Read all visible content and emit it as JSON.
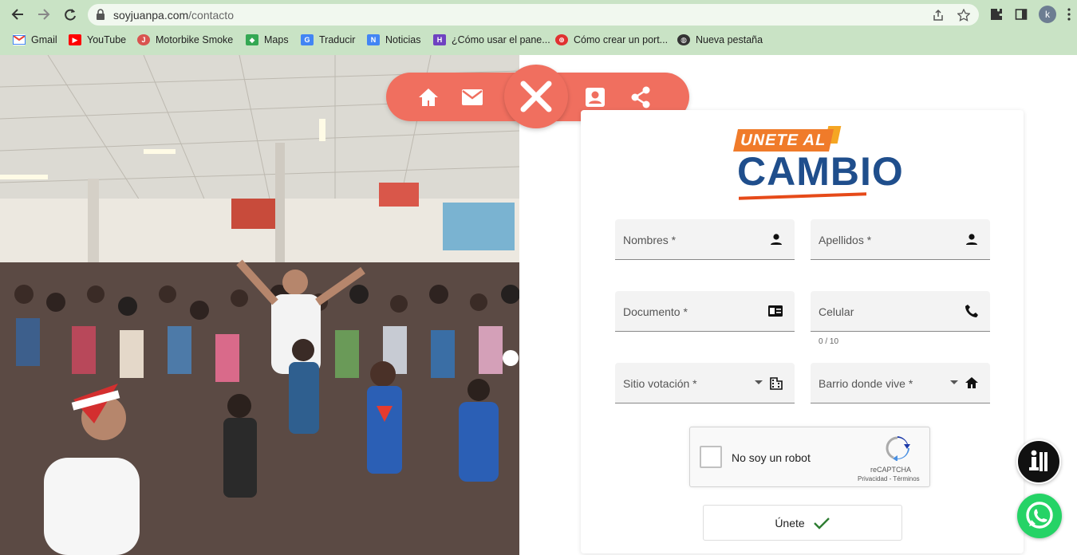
{
  "browser": {
    "url_host": "soyjuanpa.com",
    "url_path": "/contacto",
    "profile_initial": "k",
    "bookmarks": [
      {
        "label": "Gmail",
        "icon": "gmail-icon",
        "color": "#ea4335"
      },
      {
        "label": "YouTube",
        "icon": "youtube-icon",
        "color": "#ff0000"
      },
      {
        "label": "Motorbike Smoke",
        "icon": "motorbike-smoke-icon",
        "color": "#d9534f"
      },
      {
        "label": "Maps",
        "icon": "maps-icon",
        "color": "#34a853"
      },
      {
        "label": "Traducir",
        "icon": "translate-icon",
        "color": "#4285f4"
      },
      {
        "label": "Noticias",
        "icon": "news-icon",
        "color": "#4285f4"
      },
      {
        "label": "¿Cómo usar el pane...",
        "icon": "panel-icon",
        "color": "#6f42c1"
      },
      {
        "label": "Cómo crear un port...",
        "icon": "portfolio-icon",
        "color": "#e03131"
      },
      {
        "label": "Nueva pestaña",
        "icon": "globe-icon",
        "color": "#333333"
      }
    ]
  },
  "floating_nav": {
    "items": [
      "home-icon",
      "mail-icon",
      "close-icon",
      "contact-icon",
      "share-icon"
    ],
    "accent": "#f06f5f"
  },
  "form": {
    "logo_line1": "UNETE AL",
    "logo_line2": "CAMBIO",
    "fields": {
      "nombres": "Nombres *",
      "apellidos": "Apellidos *",
      "documento": "Documento *",
      "celular": "Celular",
      "celular_hint": "0 / 10",
      "sitio": "Sitio votación *",
      "barrio": "Barrio donde vive *"
    },
    "captcha": {
      "label": "No soy un robot",
      "brand": "reCAPTCHA",
      "links": "Privacidad - Términos"
    },
    "submit_label": "Únete"
  }
}
